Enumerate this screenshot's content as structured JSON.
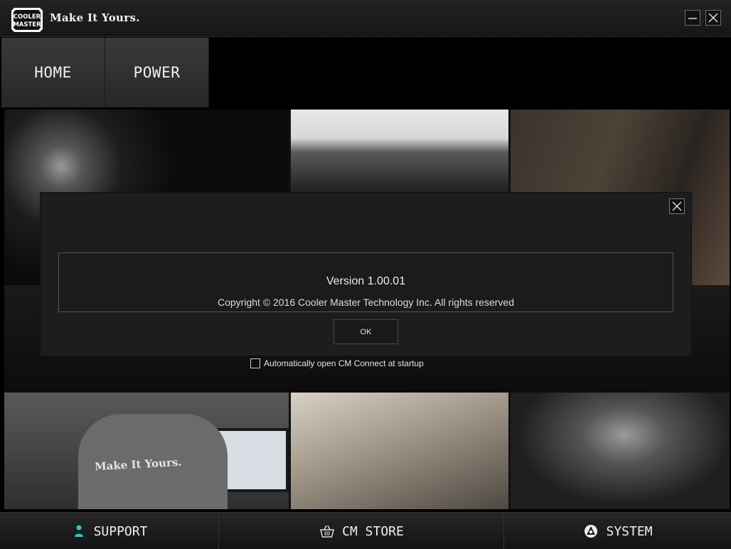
{
  "window": {
    "tagline": "Make It Yours.",
    "logo_text": "COOLER MASTER"
  },
  "nav": {
    "tabs": [
      {
        "label": "HOME"
      },
      {
        "label": "POWER"
      }
    ]
  },
  "tiles": {
    "shirt_text": "Make It Yours."
  },
  "dialog": {
    "version": "Version 1.00.01",
    "copyright": "Copyright © 2016 Cooler Master Technology Inc. All rights reserved",
    "ok_label": "OK"
  },
  "startup": {
    "label": "Automatically open CM Connect at startup",
    "checked": false
  },
  "bottom": {
    "support": "SUPPORT",
    "store": "CM STORE",
    "system": "SYSTEM"
  },
  "colors": {
    "support_icon": "#2fc6c0"
  }
}
